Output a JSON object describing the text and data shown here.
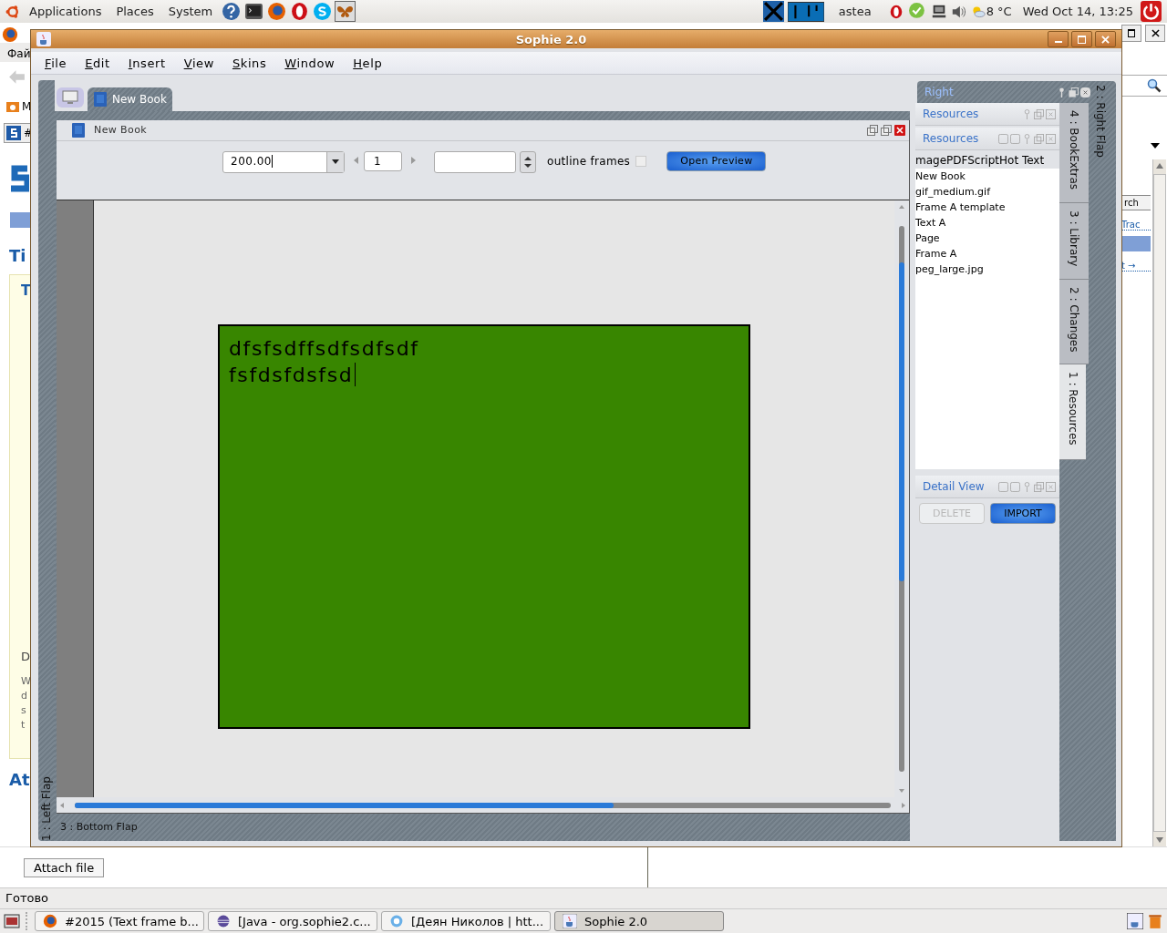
{
  "top_panel": {
    "menus": [
      "Applications",
      "Places",
      "System"
    ],
    "user": "astea",
    "weather": "8 °C",
    "clock": "Wed Oct 14, 13:25"
  },
  "browser": {
    "menu_fragment": "Фай",
    "tab_fragment": "#",
    "bookmark_fragment": "M",
    "fragments": [
      "Ti",
      "T",
      "D",
      "W",
      "d",
      "s",
      "t",
      "At"
    ],
    "side_button": "rch",
    "side_links": [
      "Trac",
      "t →"
    ],
    "attach_button": "Attach file",
    "status": "Готово"
  },
  "window": {
    "title": "Sophie 2.0"
  },
  "menu": [
    "File",
    "Edit",
    "Insert",
    "View",
    "Skins",
    "Window",
    "Help"
  ],
  "left_flap": "1 : Left Flap",
  "tabs": [
    {
      "kind": "monitor",
      "selected": false
    },
    {
      "kind": "book",
      "label": "New Book",
      "selected": true
    }
  ],
  "document": {
    "title": "New Book",
    "zoom": "200.00",
    "page": "1",
    "outline_label": "outline frames",
    "outline_checked": false,
    "preview_button": "Open Preview",
    "frame_lines": [
      "dfsfsdffsdfsdfsdf",
      "fsfdsfdsfsd"
    ]
  },
  "right_flap": {
    "title": "Right",
    "label": "2 : Right Flap",
    "section": "Resources",
    "list_title": "Resources",
    "list_header": "magePDFScriptHot Text",
    "items": [
      "New Book",
      "gif_medium.gif",
      "Frame A template",
      "Text A",
      "Page",
      "Frame A",
      "peg_large.jpg"
    ],
    "detail_title": "Detail View",
    "buttons": [
      {
        "label": "DELETE",
        "disabled": true
      },
      {
        "label": "IMPORT",
        "disabled": false
      }
    ],
    "side_tabs": [
      {
        "label": "4 : BookExtras",
        "selected": false
      },
      {
        "label": "3 : Library",
        "selected": false
      },
      {
        "label": "2 : Changes",
        "selected": false
      },
      {
        "label": "1 : Resources",
        "selected": true
      }
    ]
  },
  "bottom_flap": "3 : Bottom Flap",
  "taskbar": [
    {
      "kind": "firefox",
      "label": "#2015 (Text frame b...",
      "selected": false
    },
    {
      "kind": "eclipse",
      "label": "[Java - org.sophie2.c...",
      "selected": false
    },
    {
      "kind": "chat",
      "label": "[Деян Николов | htt...",
      "selected": false
    },
    {
      "kind": "java",
      "label": "Sophie 2.0",
      "selected": true
    }
  ]
}
